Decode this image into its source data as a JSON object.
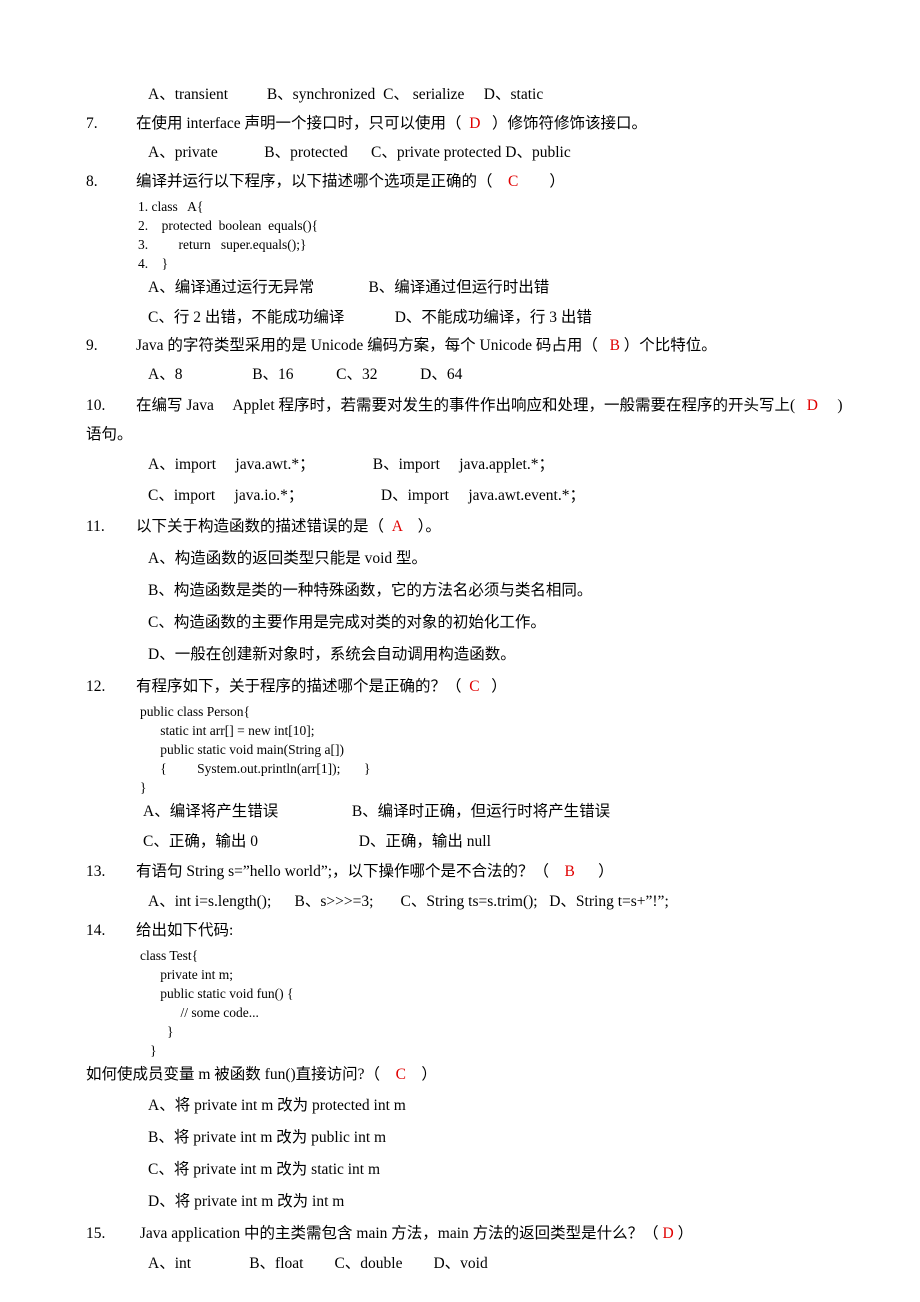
{
  "meta": {
    "doc_type": "exam-paper",
    "language": "zh-CN",
    "answer_color": "#e00000"
  },
  "q6_options_tail": {
    "a": "A、transient",
    "b": "B、synchronized",
    "c": "C、 serialize",
    "d": "D、static"
  },
  "questions": [
    {
      "id": "q7",
      "number": "7.",
      "stem_before": "在使用 interface 声明一个接口时，只可以使用（",
      "answer": "D",
      "stem_after": "）修饰符修饰该接口。",
      "options": {
        "a": "A、private",
        "b": "B、protected",
        "c": "C、private  protected",
        "d": "D、public"
      }
    },
    {
      "id": "q8",
      "number": "8.",
      "stem_before": "编译并运行以下程序，以下描述哪个选项是正确的（",
      "answer": "C",
      "stem_after": "）",
      "code": [
        "1. class   A{",
        "2.    protected  boolean  equals(){",
        "3.         return   super.equals();}",
        "4.    }"
      ],
      "options": {
        "a": "A、编译通过运行无异常",
        "b": "B、编译通过但运行时出错",
        "c": "C、行 2 出错，不能成功编译",
        "d": "D、不能成功编译，行 3 出错"
      }
    },
    {
      "id": "q9",
      "number": "9.",
      "stem_before": "Java 的字符类型采用的是 Unicode 编码方案，每个 Unicode 码占用（",
      "answer": "B",
      "stem_after": "）个比特位。",
      "options": {
        "a": "A、8",
        "b": "B、16",
        "c": "C、32",
        "d": "D、64"
      }
    },
    {
      "id": "q10",
      "number": "10.",
      "stem_before": "在编写 Java　 Applet 程序时，若需要对发生的事件作出响应和处理，一般需要在程序的开头写上(",
      "answer": "D",
      "stem_after": ")",
      "stem_line2": "语句。",
      "options": {
        "a": "A、import　 java.awt.*；",
        "b": "B、import　 java.applet.*；",
        "c": "C、import　 java.io.*；",
        "d": "D、import　 java.awt.event.*；"
      }
    },
    {
      "id": "q11",
      "number": "11.",
      "stem_before": "以下关于构造函数的描述错误的是（",
      "answer": "A",
      "stem_after": "）。",
      "options": {
        "a": "A、构造函数的返回类型只能是 void 型。",
        "b": "B、构造函数是类的一种特殊函数，它的方法名必须与类名相同。",
        "c": "C、构造函数的主要作用是完成对类的对象的初始化工作。",
        "d": "D、一般在创建新对象时，系统会自动调用构造函数。"
      }
    },
    {
      "id": "q12",
      "number": "12.",
      "stem_before": "有程序如下，关于程序的描述哪个是正确的？（",
      "answer": "C",
      "stem_after": "）",
      "code": [
        "public class Person{",
        "      static int arr[] = new int[10];",
        "      public static void main(String a[])",
        "      {         System.out.println(arr[1]);       }",
        "}"
      ],
      "options": {
        "a": "A、编译将产生错误",
        "b": "B、编译时正确，但运行时将产生错误",
        "c": "C、正确，输出 0",
        "d": "D、正确，输出 null"
      }
    },
    {
      "id": "q13",
      "number": "13.",
      "stem_before": "有语句 String s=”hello world”;，以下操作哪个是不合法的？（",
      "answer": "B",
      "stem_after": "）",
      "options": {
        "a": "A、int i=s.length();",
        "b": "B、s>>>=3;",
        "c": "C、String ts=s.trim();",
        "d": "D、String t=s+”!”;"
      }
    },
    {
      "id": "q14",
      "number": "14.",
      "stem_before": "给出如下代码:",
      "answer": "",
      "stem_after": "",
      "code": [
        "class Test{",
        "      private int m;",
        "      public static void fun() {",
        "            // some code...",
        "        }",
        "   }"
      ],
      "question_line_before": "如何使成员变量 m 被函数 fun()直接访问?（",
      "question_answer": "C",
      "question_line_after": "）",
      "options": {
        "a": "A、将 private int m 改为 protected int m",
        "b": "B、将 private int m 改为 public int m",
        "c": "C、将 private int m 改为 static int m",
        "d": "D、将 private int m 改为 int m"
      }
    },
    {
      "id": "q15",
      "number": "15.",
      "stem_before": " Java application 中的主类需包含 main 方法，main 方法的返回类型是什么？（",
      "answer": "D",
      "stem_after": "）",
      "options": {
        "a": "A、int",
        "b": "B、float",
        "c": "C、double",
        "d": "D、void"
      }
    }
  ]
}
